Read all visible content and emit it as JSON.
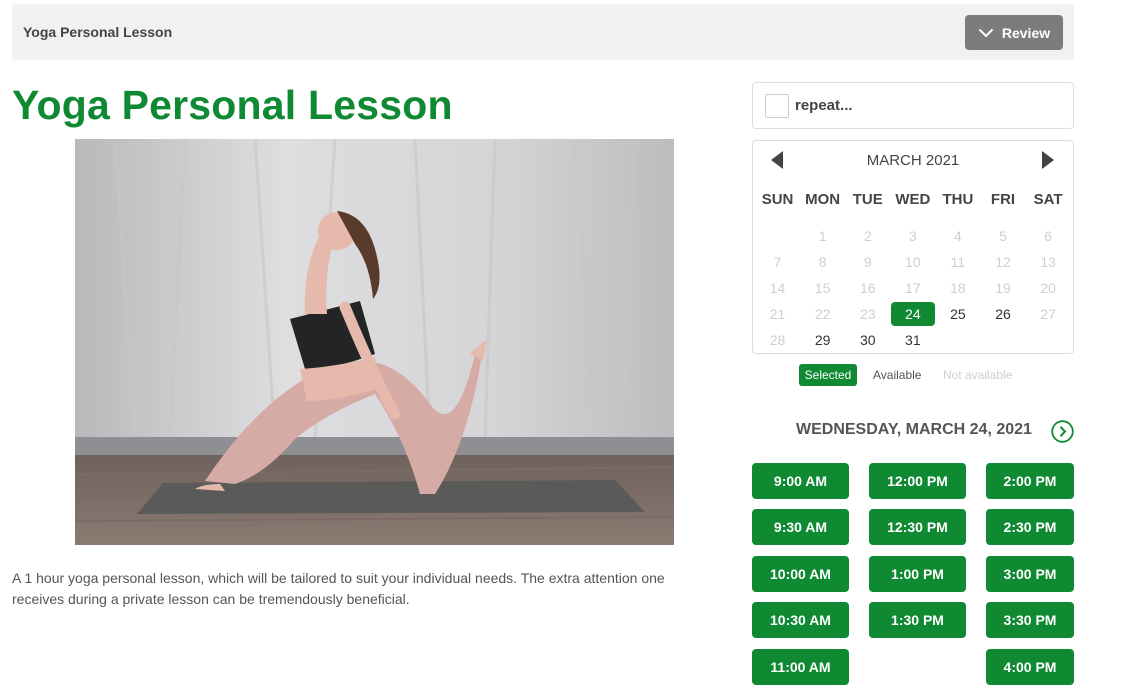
{
  "topbar": {
    "title": "Yoga Personal Lesson",
    "review_label": "Review"
  },
  "page": {
    "title": "Yoga Personal Lesson",
    "description": "A 1 hour yoga personal lesson, which will be tailored to suit your individual needs. The extra attention one receives during a private lesson can be tremendously beneficial."
  },
  "repeat": {
    "label": "repeat..."
  },
  "calendar": {
    "month_label": "MARCH 2021",
    "weekdays": [
      "SUN",
      "MON",
      "TUE",
      "WED",
      "THU",
      "FRI",
      "SAT"
    ],
    "leading_blanks": 1,
    "days": [
      {
        "d": "1",
        "s": "na"
      },
      {
        "d": "2",
        "s": "na"
      },
      {
        "d": "3",
        "s": "na"
      },
      {
        "d": "4",
        "s": "na"
      },
      {
        "d": "5",
        "s": "na"
      },
      {
        "d": "6",
        "s": "na"
      },
      {
        "d": "7",
        "s": "na"
      },
      {
        "d": "8",
        "s": "na"
      },
      {
        "d": "9",
        "s": "na"
      },
      {
        "d": "10",
        "s": "na"
      },
      {
        "d": "11",
        "s": "na"
      },
      {
        "d": "12",
        "s": "na"
      },
      {
        "d": "13",
        "s": "na"
      },
      {
        "d": "14",
        "s": "na"
      },
      {
        "d": "15",
        "s": "na"
      },
      {
        "d": "16",
        "s": "na"
      },
      {
        "d": "17",
        "s": "na"
      },
      {
        "d": "18",
        "s": "na"
      },
      {
        "d": "19",
        "s": "na"
      },
      {
        "d": "20",
        "s": "na"
      },
      {
        "d": "21",
        "s": "na"
      },
      {
        "d": "22",
        "s": "na"
      },
      {
        "d": "23",
        "s": "na"
      },
      {
        "d": "24",
        "s": "sel"
      },
      {
        "d": "25",
        "s": "av"
      },
      {
        "d": "26",
        "s": "av"
      },
      {
        "d": "27",
        "s": "na"
      },
      {
        "d": "28",
        "s": "na"
      },
      {
        "d": "29",
        "s": "av"
      },
      {
        "d": "30",
        "s": "av"
      },
      {
        "d": "31",
        "s": "av"
      }
    ]
  },
  "legend": {
    "selected": "Selected",
    "available": "Available",
    "not_available": "Not available"
  },
  "schedule": {
    "date_heading": "WEDNESDAY, MARCH 24, 2021",
    "columns": [
      [
        "9:00 AM",
        "9:30 AM",
        "10:00 AM",
        "10:30 AM",
        "11:00 AM"
      ],
      [
        "12:00 PM",
        "12:30 PM",
        "1:00 PM",
        "1:30 PM"
      ],
      [
        "2:00 PM",
        "2:30 PM",
        "3:00 PM",
        "3:30 PM",
        "4:00 PM"
      ]
    ]
  },
  "colors": {
    "brand_green": "#0f8a33",
    "review_grey": "#7c7c7c",
    "topbar_bg": "#f1f1f1"
  },
  "icons": {
    "review": "chevron-down-icon",
    "prev_month": "caret-left-icon",
    "next_month": "caret-right-icon",
    "next_day": "circle-chevron-right-icon"
  }
}
